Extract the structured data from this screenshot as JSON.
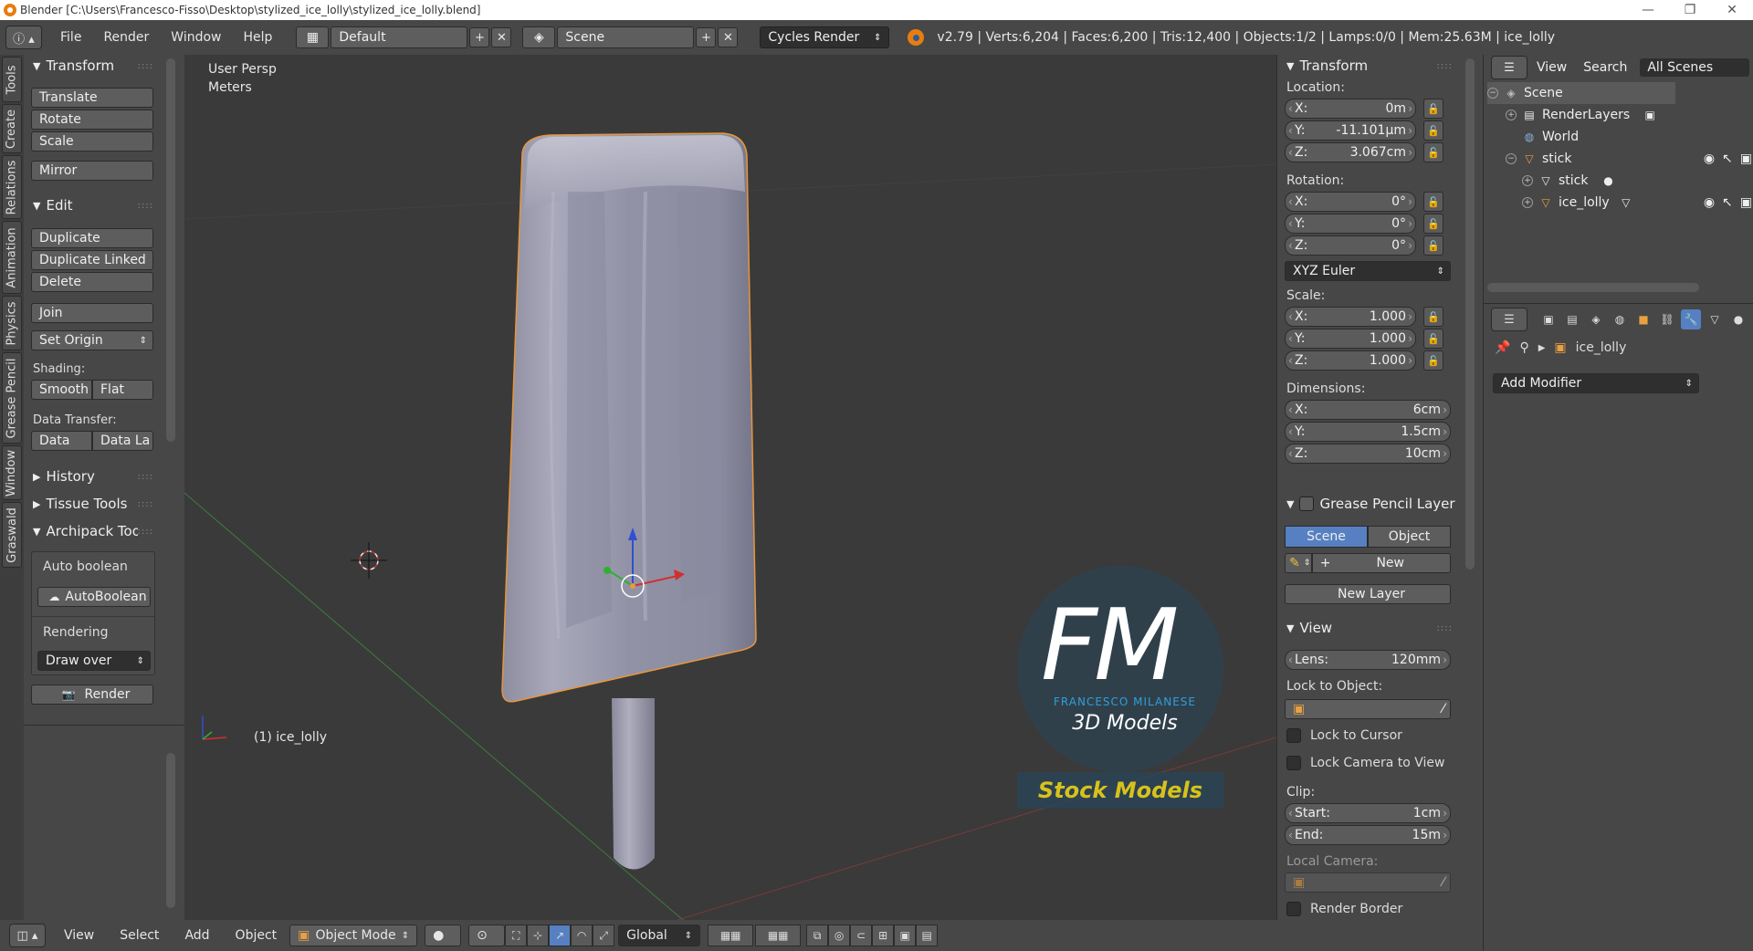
{
  "window": {
    "title": "Blender [C:\\Users\\Francesco-Fisso\\Desktop\\stylized_ice_lolly\\stylized_ice_lolly.blend]",
    "minimize": "—",
    "maximize": "❐",
    "close": "✕"
  },
  "infobar": {
    "menus": [
      "File",
      "Render",
      "Window",
      "Help"
    ],
    "screen_layout": "Default",
    "scene": "Scene",
    "render_engine": "Cycles Render",
    "stats": "v2.79 | Verts:6,204 | Faces:6,200 | Tris:12,400 | Objects:1/2 | Lamps:0/0 | Mem:25.63M | ice_lolly"
  },
  "vtabs": [
    "Tools",
    "Create",
    "Relations",
    "Animation",
    "Physics",
    "Grease Pencil",
    "Window",
    "Graswald"
  ],
  "toolshelf": {
    "transform": {
      "title": "Transform",
      "translate": "Translate",
      "rotate": "Rotate",
      "scale": "Scale",
      "mirror": "Mirror"
    },
    "edit": {
      "title": "Edit",
      "duplicate": "Duplicate",
      "duplicate_linked": "Duplicate Linked",
      "delete": "Delete",
      "join": "Join",
      "set_origin": "Set Origin",
      "shading_label": "Shading:",
      "smooth": "Smooth",
      "flat": "Flat",
      "data_transfer_label": "Data Transfer:",
      "data": "Data",
      "data_la": "Data La"
    },
    "history": "History",
    "tissue_tools": "Tissue Tools",
    "archipack": {
      "title": "Archipack Tools",
      "auto_boolean_label": "Auto boolean",
      "auto_boolean_btn": "AutoBoolean",
      "rendering_label": "Rendering",
      "draw_over": "Draw over",
      "render": "Render"
    }
  },
  "viewport": {
    "view_name": "User Persp",
    "units": "Meters",
    "object_label": "(1) ice_lolly",
    "watermark": {
      "letters": "FM",
      "name": "FRANCESCO MILANESE",
      "subtitle": "3D Models",
      "banner": "Stock Models"
    }
  },
  "footer": {
    "menus": [
      "View",
      "Select",
      "Add",
      "Object"
    ],
    "mode": "Object Mode",
    "orientation": "Global"
  },
  "npanel": {
    "transform_title": "Transform",
    "location_label": "Location:",
    "location": [
      {
        "axis": "X:",
        "value": "0m"
      },
      {
        "axis": "Y:",
        "value": "-11.101µm"
      },
      {
        "axis": "Z:",
        "value": "3.067cm"
      }
    ],
    "rotation_label": "Rotation:",
    "rotation": [
      {
        "axis": "X:",
        "value": "0°"
      },
      {
        "axis": "Y:",
        "value": "0°"
      },
      {
        "axis": "Z:",
        "value": "0°"
      }
    ],
    "rotation_mode": "XYZ Euler",
    "scale_label": "Scale:",
    "scale": [
      {
        "axis": "X:",
        "value": "1.000"
      },
      {
        "axis": "Y:",
        "value": "1.000"
      },
      {
        "axis": "Z:",
        "value": "1.000"
      }
    ],
    "dimensions_label": "Dimensions:",
    "dimensions": [
      {
        "axis": "X:",
        "value": "6cm"
      },
      {
        "axis": "Y:",
        "value": "1.5cm"
      },
      {
        "axis": "Z:",
        "value": "10cm"
      }
    ],
    "grease_pencil_title": "Grease Pencil Layer",
    "gp_scene": "Scene",
    "gp_object": "Object",
    "gp_new": "New",
    "gp_new_layer": "New Layer",
    "view_title": "View",
    "lens_label": "Lens:",
    "lens_value": "120mm",
    "lock_to_object": "Lock to Object:",
    "lock_to_cursor": "Lock to Cursor",
    "lock_camera": "Lock Camera to View",
    "clip_label": "Clip:",
    "clip_start_label": "Start:",
    "clip_start": "1cm",
    "clip_end_label": "End:",
    "clip_end": "15m",
    "local_camera": "Local Camera:",
    "render_border": "Render Border"
  },
  "outliner": {
    "view": "View",
    "search": "Search",
    "all_scenes": "All Scenes",
    "items": [
      {
        "label": "Scene"
      },
      {
        "label": "RenderLayers"
      },
      {
        "label": "World"
      },
      {
        "label": "stick"
      },
      {
        "label": "stick"
      },
      {
        "label": "ice_lolly"
      }
    ]
  },
  "properties": {
    "object_name": "ice_lolly",
    "add_modifier": "Add Modifier"
  },
  "colors": {
    "accent_blue": "#5680c2",
    "selection_orange": "#e89a3c",
    "watermark_yellow": "#d8c21a",
    "watermark_blue": "#2b7fb8"
  }
}
